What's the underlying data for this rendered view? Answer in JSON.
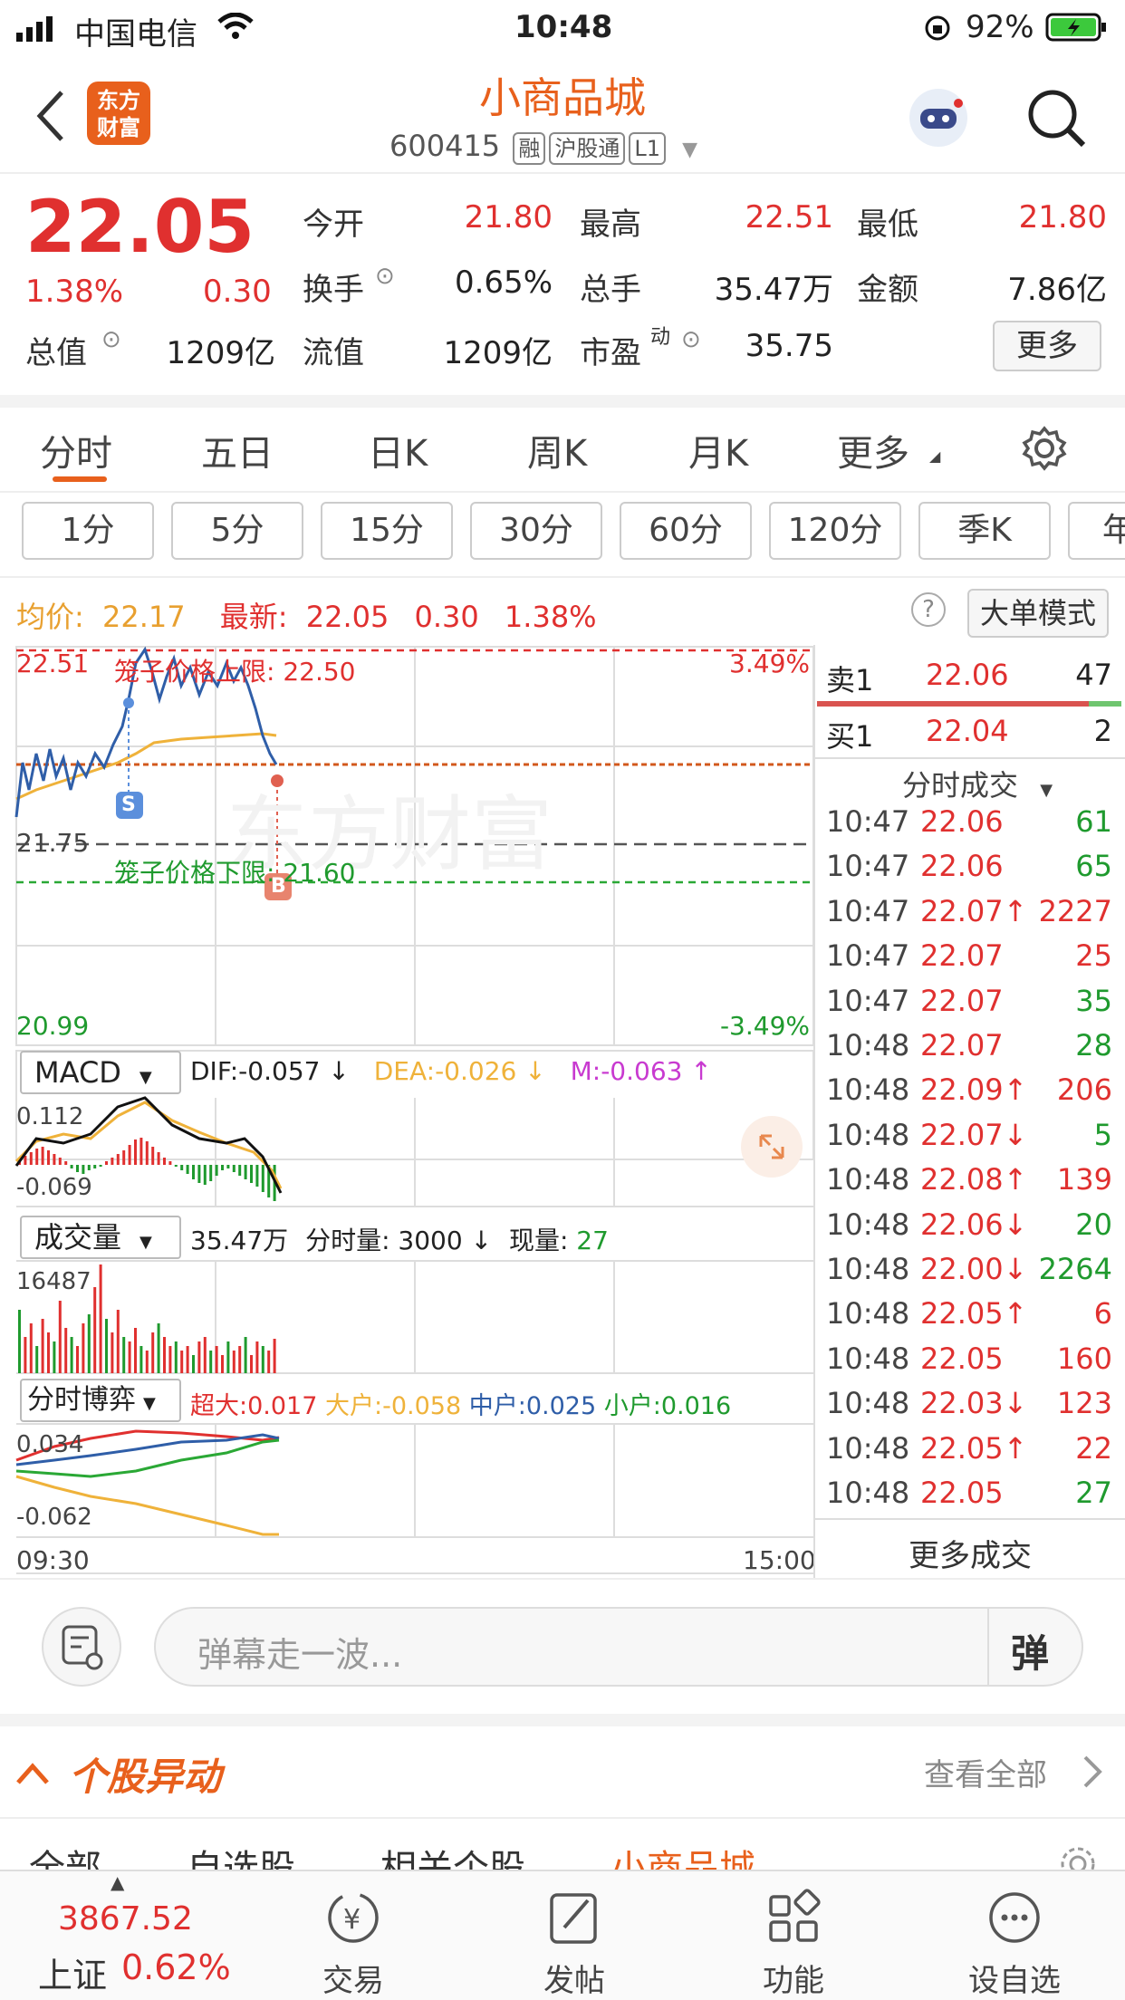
{
  "status": {
    "carrier": "中国电信",
    "time": "10:48",
    "battery": "92%"
  },
  "header": {
    "title": "小商品城",
    "code": "600415",
    "tags": [
      "融",
      "沪股通",
      "L1"
    ],
    "logo_line1": "东方",
    "logo_line2": "财富"
  },
  "quote": {
    "price": "22.05",
    "change_pct": "1.38%",
    "change": "0.30",
    "fields": [
      {
        "label": "今开",
        "value": "21.80",
        "color": "red"
      },
      {
        "label": "最高",
        "value": "22.51",
        "color": "red"
      },
      {
        "label": "最低",
        "value": "21.80",
        "color": "red"
      },
      {
        "label": "换手",
        "value": "0.65%",
        "color": "dark"
      },
      {
        "label": "总手",
        "value": "35.47万",
        "color": "dark"
      },
      {
        "label": "金额",
        "value": "7.86亿",
        "color": "dark"
      },
      {
        "label": "总值",
        "value": "1209亿",
        "color": "dark"
      },
      {
        "label": "流值",
        "value": "1209亿",
        "color": "dark"
      },
      {
        "label": "市盈",
        "value": "35.75",
        "color": "dark"
      }
    ],
    "pe_suffix": "动",
    "more_label": "更多"
  },
  "tabs": [
    "分时",
    "五日",
    "日K",
    "周K",
    "月K",
    "更多"
  ],
  "subtabs": [
    "1分",
    "5分",
    "15分",
    "30分",
    "60分",
    "120分",
    "季K",
    "年"
  ],
  "info": {
    "avg_label": "均价:",
    "avg": "22.17",
    "latest_label": "最新:",
    "latest": "22.05",
    "chg": "0.30",
    "pct": "1.38%",
    "big_order": "大单模式"
  },
  "chart": {
    "top_price": "22.51",
    "top_pct": "3.49%",
    "upper_limit": "笼子价格上限:  22.50",
    "mid_price": "21.75",
    "lower_limit": "笼子价格下限:  21.60",
    "bottom_price": "20.99",
    "bottom_pct": "-3.49%",
    "start_time": "09:30",
    "end_time": "15:00",
    "watermark": "东方财富",
    "marker_s": "S",
    "marker_b": "B"
  },
  "macd": {
    "label": "MACD",
    "dif": "DIF:-0.057 ↓",
    "dea": "DEA:-0.026 ↓",
    "m": "M:-0.063 ↑",
    "top": "0.112",
    "bottom": "-0.069"
  },
  "volume": {
    "label": "成交量",
    "total": "35.47万",
    "fenshi": "分时量: 3000 ↓",
    "xian_label": "现量:",
    "xian": "27",
    "top": "16487"
  },
  "boyi": {
    "label": "分时博弈",
    "chaoda": "超大:0.017",
    "dahu": "大户:-0.058",
    "zhonghu": "中户:0.025",
    "xiaohu": "小户:0.016",
    "top": "0.034",
    "bottom": "-0.062"
  },
  "orderbook": {
    "sell_label": "卖1",
    "sell_price": "22.06",
    "sell_vol": "47",
    "buy_label": "买1",
    "buy_price": "22.04",
    "buy_vol": "2"
  },
  "trades_title": "分时成交",
  "trades": [
    {
      "t": "10:47",
      "p": "22.06",
      "v": "61",
      "vc": "green"
    },
    {
      "t": "10:47",
      "p": "22.06",
      "v": "65",
      "vc": "green"
    },
    {
      "t": "10:47",
      "p": "22.07↑",
      "v": "2227",
      "vc": "red"
    },
    {
      "t": "10:47",
      "p": "22.07",
      "v": "25",
      "vc": "red"
    },
    {
      "t": "10:47",
      "p": "22.07",
      "v": "35",
      "vc": "green"
    },
    {
      "t": "10:48",
      "p": "22.07",
      "v": "28",
      "vc": "green"
    },
    {
      "t": "10:48",
      "p": "22.09↑",
      "v": "206",
      "vc": "red"
    },
    {
      "t": "10:48",
      "p": "22.07↓",
      "v": "5",
      "vc": "green"
    },
    {
      "t": "10:48",
      "p": "22.08↑",
      "v": "139",
      "vc": "red"
    },
    {
      "t": "10:48",
      "p": "22.06↓",
      "v": "20",
      "vc": "green"
    },
    {
      "t": "10:48",
      "p": "22.00↓",
      "v": "2264",
      "vc": "green"
    },
    {
      "t": "10:48",
      "p": "22.05↑",
      "v": "6",
      "vc": "red"
    },
    {
      "t": "10:48",
      "p": "22.05",
      "v": "160",
      "vc": "red"
    },
    {
      "t": "10:48",
      "p": "22.03↓",
      "v": "123",
      "vc": "red"
    },
    {
      "t": "10:48",
      "p": "22.05↑",
      "v": "22",
      "vc": "red"
    },
    {
      "t": "10:48",
      "p": "22.05",
      "v": "27",
      "vc": "green"
    }
  ],
  "more_trades": "更多成交",
  "danmu": {
    "placeholder": "弹幕走一波...",
    "btn": "弹"
  },
  "yidong": {
    "title": "个股异动",
    "view_all": "查看全部",
    "tabs": [
      "全部",
      "自选股",
      "相关个股",
      "小商品城"
    ]
  },
  "tabbar": {
    "index_value": "3867.52",
    "index_name": "上证",
    "index_pct": "0.62%",
    "items": [
      "交易",
      "发帖",
      "功能",
      "设自选"
    ]
  }
}
